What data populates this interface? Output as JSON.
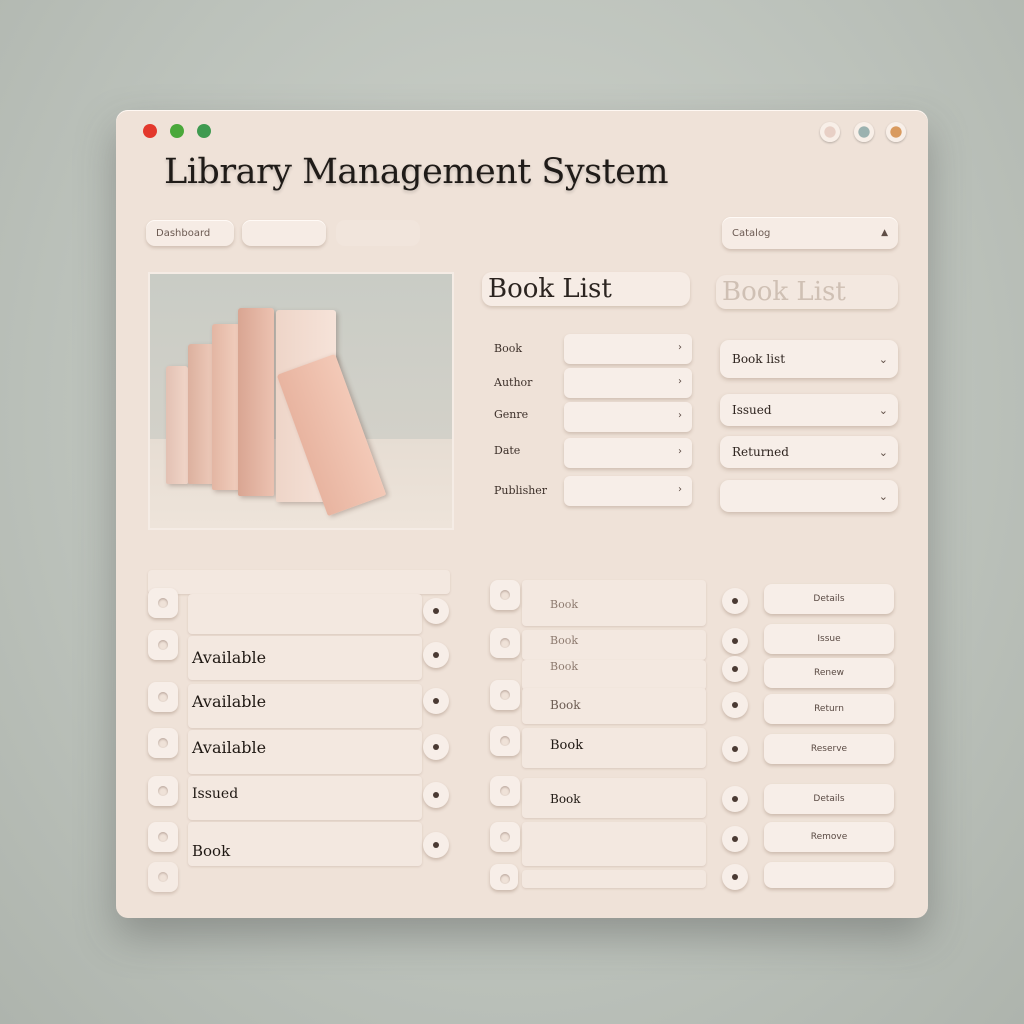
{
  "window": {
    "title": "Library Management System",
    "traffic_colors": [
      "#e3382c",
      "#4aa83a",
      "#3f9a50"
    ],
    "right_dot_colors": [
      "#e8d0c6",
      "#9bb2b0",
      "#d99a5e"
    ]
  },
  "nav": {
    "tab1": "Dashboard",
    "tab2": "",
    "tab3": "",
    "dropdown": "Catalog"
  },
  "headings": {
    "left": "Book List",
    "right": "Book List"
  },
  "form_labels": [
    "Book",
    "Author",
    "Genre",
    "Date",
    "Publisher"
  ],
  "dropdowns": [
    "Book list",
    "Issued",
    "Returned",
    ""
  ],
  "left_rows": [
    {
      "text": "",
      "size": "small"
    },
    {
      "text": "Available"
    },
    {
      "text": "Available"
    },
    {
      "text": "Available"
    },
    {
      "text": "Issued"
    },
    {
      "text": "Book"
    }
  ],
  "left_header_note": "",
  "middle_rows": [
    "Book",
    "Book",
    "Book",
    "Book",
    "Book",
    "Book",
    ""
  ],
  "action_buttons": [
    "Details",
    "Issue",
    "Renew",
    "Return",
    "Reserve",
    "Details",
    "Remove"
  ]
}
